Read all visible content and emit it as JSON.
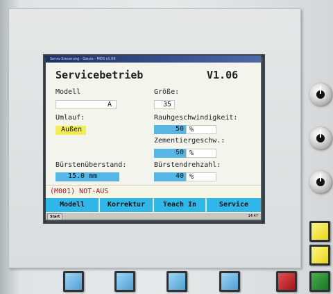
{
  "window": {
    "title": "Servo-Steuerung - Gauss - MDS v1.06"
  },
  "header": {
    "title": "Servicebetrieb",
    "version": "V1.06"
  },
  "left": {
    "modell_label": "Modell",
    "modell_value": "A",
    "umlauf_label": "Umlauf:",
    "umlauf_value": "Außen",
    "buerste_label": "Bürstenüberstand:",
    "buerste_value": "15.0 mm"
  },
  "right": {
    "groesse_label": "Größe:",
    "groesse_value": "35",
    "rauh_label": "Rauhgeschwindigkeit:",
    "rauh_value": "50",
    "rauh_unit": "%",
    "zement_label": "Zementiergeschw.:",
    "zement_value": "50",
    "zement_unit": "%",
    "drehzahl_label": "Bürstendrehzahl:",
    "drehzahl_value": "40",
    "drehzahl_unit": "%"
  },
  "message": "(M001) NOT-AUS",
  "fkeys": [
    "Modell",
    "Korrektur",
    "Teach In",
    "Service"
  ],
  "taskbar": {
    "start": "Start",
    "clock": "14:47"
  },
  "colors": {
    "field_blue": "#56b6e6",
    "field_yellow": "#f3ec52",
    "fkey_blue": "#2fb7ea"
  }
}
